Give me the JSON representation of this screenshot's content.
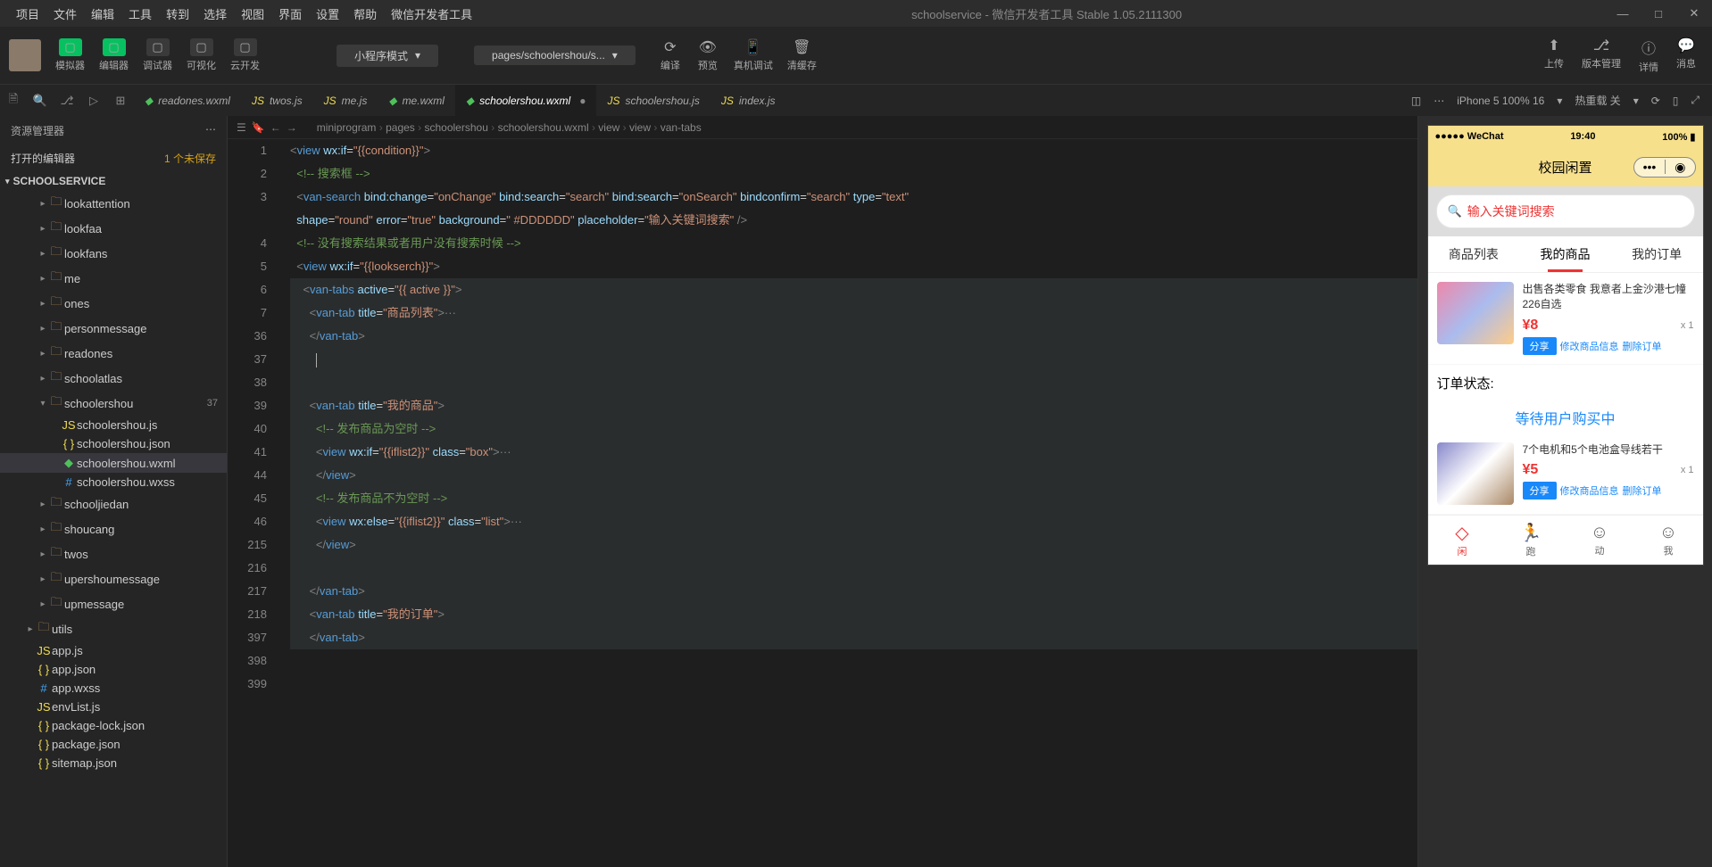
{
  "menubar": {
    "items": [
      "项目",
      "文件",
      "编辑",
      "工具",
      "转到",
      "选择",
      "视图",
      "界面",
      "设置",
      "帮助",
      "微信开发者工具"
    ],
    "title": "schoolservice - 微信开发者工具 Stable 1.05.2111300"
  },
  "toolbar": {
    "left": [
      {
        "label": "模拟器",
        "green": true
      },
      {
        "label": "编辑器",
        "green": true
      },
      {
        "label": "调试器"
      },
      {
        "label": "可视化"
      },
      {
        "label": "云开发"
      }
    ],
    "mode": "小程序模式",
    "page": "pages/schoolershou/s...",
    "center": [
      "编译",
      "预览",
      "真机调试",
      "清缓存"
    ],
    "right": [
      "上传",
      "版本管理",
      "详情",
      "消息"
    ]
  },
  "tabs": [
    {
      "name": "readones.wxml",
      "type": "wxml"
    },
    {
      "name": "twos.js",
      "type": "js"
    },
    {
      "name": "me.js",
      "type": "js"
    },
    {
      "name": "me.wxml",
      "type": "wxml"
    },
    {
      "name": "schoolershou.wxml",
      "type": "wxml",
      "active": true,
      "dirty": true
    },
    {
      "name": "schoolershou.js",
      "type": "js"
    },
    {
      "name": "index.js",
      "type": "js"
    }
  ],
  "tabsRight": {
    "device": "iPhone 5 100% 16",
    "reload": "热重载 关"
  },
  "sidebar": {
    "title": "资源管理器",
    "openEditors": {
      "label": "打开的编辑器",
      "badge": "1 个未保存"
    },
    "project": "SCHOOLSERVICE",
    "tree": [
      {
        "label": "lookattention",
        "type": "folder",
        "indent": 3
      },
      {
        "label": "lookfaa",
        "type": "folder",
        "indent": 3
      },
      {
        "label": "lookfans",
        "type": "folder",
        "indent": 3
      },
      {
        "label": "me",
        "type": "folder",
        "indent": 3
      },
      {
        "label": "ones",
        "type": "folder",
        "indent": 3
      },
      {
        "label": "personmessage",
        "type": "folder",
        "indent": 3
      },
      {
        "label": "readones",
        "type": "folder",
        "indent": 3
      },
      {
        "label": "schoolatlas",
        "type": "folder",
        "indent": 3
      },
      {
        "label": "schoolershou",
        "type": "folder",
        "indent": 3,
        "open": true,
        "num": "37"
      },
      {
        "label": "schoolershou.js",
        "type": "js",
        "indent": 4
      },
      {
        "label": "schoolershou.json",
        "type": "json",
        "indent": 4
      },
      {
        "label": "schoolershou.wxml",
        "type": "wxml",
        "indent": 4,
        "active": true
      },
      {
        "label": "schoolershou.wxss",
        "type": "wxss",
        "indent": 4
      },
      {
        "label": "schooljiedan",
        "type": "folder",
        "indent": 3
      },
      {
        "label": "shoucang",
        "type": "folder",
        "indent": 3
      },
      {
        "label": "twos",
        "type": "folder",
        "indent": 3
      },
      {
        "label": "upershoumessage",
        "type": "folder",
        "indent": 3
      },
      {
        "label": "upmessage",
        "type": "folder",
        "indent": 3
      },
      {
        "label": "utils",
        "type": "folder",
        "indent": 2
      },
      {
        "label": "app.js",
        "type": "js",
        "indent": 2
      },
      {
        "label": "app.json",
        "type": "json",
        "indent": 2
      },
      {
        "label": "app.wxss",
        "type": "wxss",
        "indent": 2
      },
      {
        "label": "envList.js",
        "type": "js",
        "indent": 2
      },
      {
        "label": "package-lock.json",
        "type": "json",
        "indent": 2
      },
      {
        "label": "package.json",
        "type": "json",
        "indent": 2
      },
      {
        "label": "sitemap.json",
        "type": "json",
        "indent": 2
      }
    ]
  },
  "breadcrumb": [
    "miniprogram",
    "pages",
    "schoolershou",
    "schoolershou.wxml",
    "view",
    "view",
    "van-tabs"
  ],
  "code": {
    "lines": [
      {
        "n": "1",
        "html": "<span class='c-br'>&lt;</span><span class='c-tag'>view</span> <span class='c-attr'>wx:if</span>=<span class='c-str'>\"{{condition}}\"</span><span class='c-br'>&gt;</span>"
      },
      {
        "n": "2",
        "html": "  <span class='c-comment'>&lt;!-- 搜索框 --&gt;</span>"
      },
      {
        "n": "3",
        "html": "  <span class='c-br'>&lt;</span><span class='c-tag'>van-search</span> <span class='c-attr'>bind:change</span>=<span class='c-str'>\"onChange\"</span> <span class='c-attr'>bind:search</span>=<span class='c-str'>\"search\"</span> <span class='c-attr'>bind:search</span>=<span class='c-str'>\"onSearch\"</span> <span class='c-attr'>bindconfirm</span>=<span class='c-str'>\"search\"</span> <span class='c-attr'>type</span>=<span class='c-str'>\"text\"</span>"
      },
      {
        "n": "",
        "html": "  <span class='c-attr'>shape</span>=<span class='c-str'>\"round\"</span> <span class='c-attr'>error</span>=<span class='c-str'>\"true\"</span> <span class='c-attr'>background</span>=<span class='c-str'>\" #DDDDDD\"</span> <span class='c-attr'>placeholder</span>=<span class='c-str'>\"输入关键词搜索\"</span> <span class='c-br'>/&gt;</span>"
      },
      {
        "n": "4",
        "html": "  <span class='c-comment'>&lt;!-- 没有搜索结果或者用户没有搜索时候 --&gt;</span>"
      },
      {
        "n": "5",
        "html": "  <span class='c-br'>&lt;</span><span class='c-tag'>view</span> <span class='c-attr'>wx:if</span>=<span class='c-str'>\"{{lookserch}}\"</span><span class='c-br'>&gt;</span>"
      },
      {
        "n": "6",
        "html": "    <span class='c-br'>&lt;</span><span class='c-tag'>van-tabs</span> <span class='c-attr'>active</span>=<span class='c-str'>\"{{ active }}\"</span><span class='c-br'>&gt;</span>",
        "hl": true
      },
      {
        "n": "7",
        "html": "      <span class='c-br'>&lt;</span><span class='c-tag'>van-tab</span> <span class='c-attr'>title</span>=<span class='c-str'>\"商品列表\"</span><span class='c-br'>&gt;</span><span class='c-br'>···</span>",
        "hl": true
      },
      {
        "n": "36",
        "html": "      <span class='c-br'>&lt;/</span><span class='c-tag'>van-tab</span><span class='c-br'>&gt;</span>",
        "hl": true
      },
      {
        "n": "37",
        "html": "        <span class='cursor-caret'></span>",
        "hl": true
      },
      {
        "n": "38",
        "html": "",
        "hl": true
      },
      {
        "n": "39",
        "html": "      <span class='c-br'>&lt;</span><span class='c-tag'>van-tab</span> <span class='c-attr'>title</span>=<span class='c-str'>\"我的商品\"</span><span class='c-br'>&gt;</span>",
        "hl": true
      },
      {
        "n": "40",
        "html": "        <span class='c-comment'>&lt;!-- 发布商品为空时 --&gt;</span>",
        "hl": true
      },
      {
        "n": "41",
        "html": "        <span class='c-br'>&lt;</span><span class='c-tag'>view</span> <span class='c-attr'>wx:if</span>=<span class='c-str'>\"{{iflist2}}\"</span> <span class='c-attr'>class</span>=<span class='c-str'>\"box\"</span><span class='c-br'>&gt;</span><span class='c-br'>···</span>",
        "hl": true
      },
      {
        "n": "44",
        "html": "        <span class='c-br'>&lt;/</span><span class='c-tag'>view</span><span class='c-br'>&gt;</span>",
        "hl": true
      },
      {
        "n": "45",
        "html": "        <span class='c-comment'>&lt;!-- 发布商品不为空时 --&gt;</span>",
        "hl": true
      },
      {
        "n": "46",
        "html": "        <span class='c-br'>&lt;</span><span class='c-tag'>view</span> <span class='c-attr'>wx:else</span>=<span class='c-str'>\"{{iflist2}}\"</span> <span class='c-attr'>class</span>=<span class='c-str'>\"list\"</span><span class='c-br'>&gt;</span><span class='c-br'>···</span>",
        "hl": true
      },
      {
        "n": "215",
        "html": "        <span class='c-br'>&lt;/</span><span class='c-tag'>view</span><span class='c-br'>&gt;</span>",
        "hl": true
      },
      {
        "n": "216",
        "html": "",
        "hl": true
      },
      {
        "n": "217",
        "html": "      <span class='c-br'>&lt;/</span><span class='c-tag'>van-tab</span><span class='c-br'>&gt;</span>",
        "hl": true
      },
      {
        "n": "218",
        "html": "      <span class='c-br'>&lt;</span><span class='c-tag'>van-tab</span> <span class='c-attr'>title</span>=<span class='c-str'>\"我的订单\"</span><span class='c-br'>&gt;</span>",
        "hl": true
      },
      {
        "n": "397",
        "html": "      <span class='c-br'>&lt;/</span><span class='c-tag'>van-tab</span><span class='c-br'>&gt;</span>",
        "hl": true
      },
      {
        "n": "398",
        "html": ""
      },
      {
        "n": "399",
        "html": ""
      }
    ]
  },
  "simulator": {
    "statusbar": {
      "left": "●●●●● WeChat",
      "time": "19:40",
      "right": "100%"
    },
    "navTitle": "校园闲置",
    "searchPlaceholder": "输入关键词搜索",
    "tabs": [
      "商品列表",
      "我的商品",
      "我的订单"
    ],
    "activeTab": 1,
    "products": [
      {
        "title": "出售各类零食 我意者上金沙港七幢226自选",
        "price": "¥8",
        "qty": "x 1",
        "share": "分享",
        "edit": "修改商品信息",
        "del": "删除订单"
      },
      {
        "title": "7个电机和5个电池盒导线若干",
        "price": "¥5",
        "qty": "x 1",
        "share": "分享",
        "edit": "修改商品信息",
        "del": "删除订单"
      }
    ],
    "orderStatus": "订单状态:",
    "orderWait": "等待用户购买中",
    "tabbar": [
      {
        "icon": "◇",
        "label": "闲",
        "active": true
      },
      {
        "icon": "🏃",
        "label": "跑"
      },
      {
        "icon": "☺",
        "label": "动"
      },
      {
        "icon": "☺",
        "label": "我"
      }
    ]
  }
}
